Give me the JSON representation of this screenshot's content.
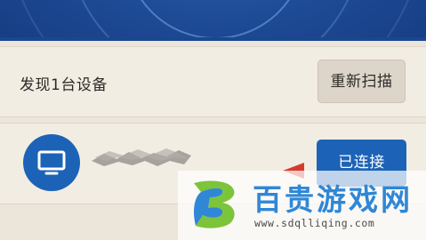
{
  "scan": {
    "found_text": "发现1台设备",
    "rescan_label": "重新扫描"
  },
  "device": {
    "icon": "tv-icon",
    "status_label": "已连接"
  },
  "watermark": {
    "title": "百贵游戏网",
    "url": "www.sdqlliqing.com",
    "brand_color": "#2f87d6"
  },
  "colors": {
    "accent": "#1c63b7",
    "alert_arrow": "#d43b2e",
    "radar": "#1e4b95"
  }
}
